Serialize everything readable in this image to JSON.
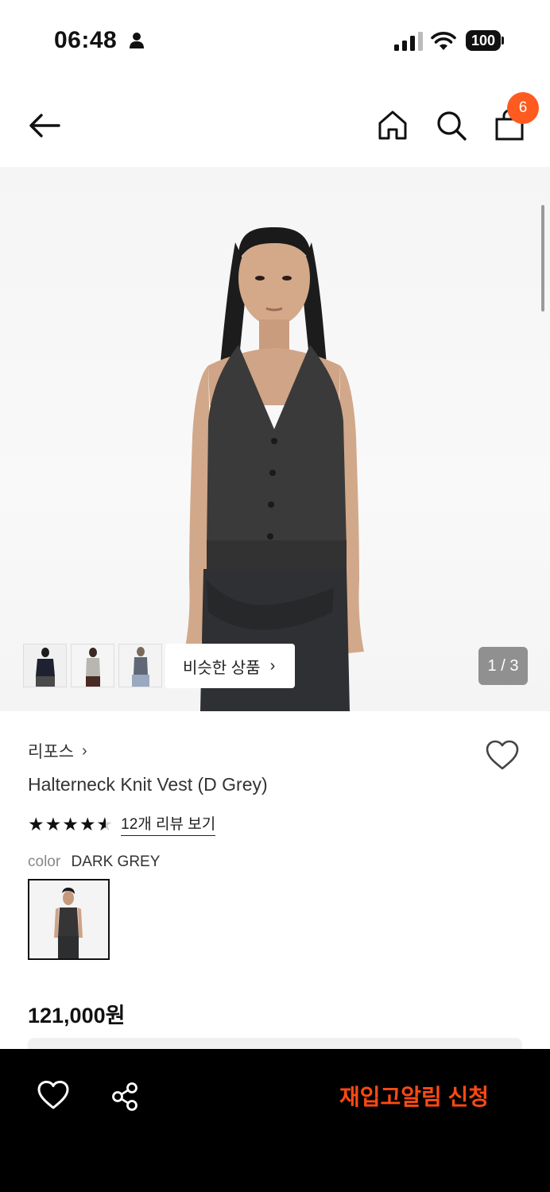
{
  "status_bar": {
    "time": "06:48",
    "battery": "100",
    "icons": [
      "person-icon",
      "signal-icon",
      "wifi-icon",
      "battery-icon"
    ]
  },
  "nav": {
    "icons": [
      "back-arrow-icon",
      "home-icon",
      "search-icon",
      "shopping-bag-icon"
    ],
    "cart_count": "6"
  },
  "gallery": {
    "similar_label": "비슷한 상품",
    "page_indicator": "1 / 3",
    "current_page": 1,
    "total_pages": 3
  },
  "product": {
    "brand": "리포스",
    "name": "Halterneck Knit Vest (D Grey)",
    "rating": 4.5,
    "review_link": "12개 리뷰 보기",
    "color_label": "color",
    "color_value": "DARK GREY",
    "price": "121,000원"
  },
  "bottom_bar": {
    "restock_label": "재입고알림 신청",
    "icons": [
      "heart-icon",
      "share-icon"
    ]
  },
  "colors": {
    "accent": "#ff5a1f",
    "restock_text": "#ff4a12",
    "bottom_bar_bg": "#000000"
  }
}
